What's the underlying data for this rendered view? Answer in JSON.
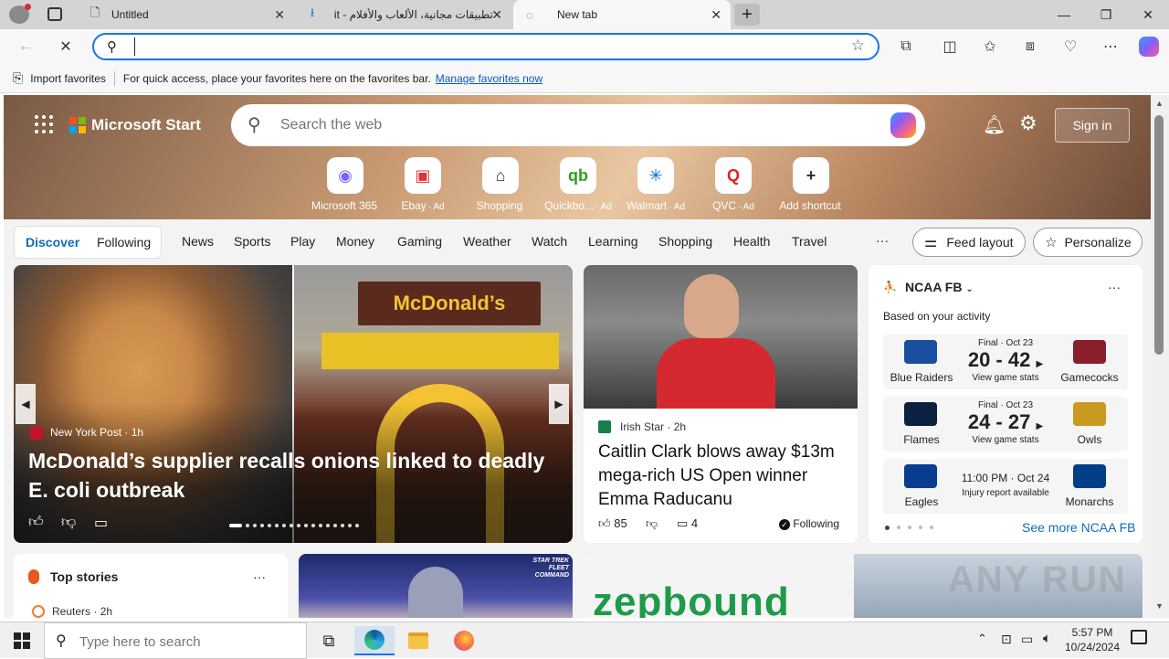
{
  "browser": {
    "tabs": [
      {
        "label": "Untitled",
        "close": "✕"
      },
      {
        "label": "تطبيقات مجانية، الألعاب والأفلام - it",
        "close": "✕"
      },
      {
        "label": "New tab",
        "close": "✕"
      }
    ],
    "new_tab_symbol": "+",
    "window_controls": {
      "minimize": "—",
      "maximize": "❐",
      "close": "✕"
    },
    "address": {
      "value": "",
      "placeholder": ""
    },
    "favorites_bar": {
      "import_label": "Import favorites",
      "message": "For quick access, place your favorites here on the favorites bar.",
      "manage_link": "Manage favorites now"
    }
  },
  "msn": {
    "brand": "Microsoft Start",
    "search_placeholder": "Search the web",
    "sign_in": "Sign in",
    "shortcuts": [
      {
        "label": "Microsoft 365",
        "ad": "",
        "icon": "microsoft-365-icon",
        "glyph": "◉",
        "color": "#7b61ff"
      },
      {
        "label": "Ebay",
        "ad": "· Ad",
        "icon": "ebay-icon",
        "glyph": "▣",
        "color": "#e53238"
      },
      {
        "label": "Shopping",
        "ad": "",
        "icon": "shopping-tag-icon",
        "glyph": "⌂",
        "color": "#333333"
      },
      {
        "label": "Quickbo...",
        "ad": "· Ad",
        "icon": "quickbooks-icon",
        "glyph": "qb",
        "color": "#2ca01c"
      },
      {
        "label": "Walmart",
        "ad": "· Ad",
        "icon": "walmart-icon",
        "glyph": "✳",
        "color": "#0071ce"
      },
      {
        "label": "QVC",
        "ad": "· Ad",
        "icon": "qvc-icon",
        "glyph": "Q",
        "color": "#e02020"
      },
      {
        "label": "Add shortcut",
        "ad": "",
        "icon": "add-shortcut-icon",
        "glyph": "+",
        "color": "#333333"
      }
    ],
    "tabs": {
      "discover": "Discover",
      "following": "Following"
    },
    "nav": [
      "News",
      "Sports",
      "Play",
      "Money",
      "Gaming",
      "Weather",
      "Watch",
      "Learning",
      "Shopping",
      "Health",
      "Travel"
    ],
    "more": "···",
    "feed_layout": "Feed layout",
    "personalize": "Personalize",
    "hero_story": {
      "source": "New York Post",
      "age": "1h",
      "headline": "McDonald’s supplier recalls onions linked to deadly E. coli outbreak"
    },
    "second_story": {
      "source": "Irish Star",
      "age": "2h",
      "headline": "Caitlin Clark blows away $13m mega-rich US Open winner Emma Raducanu",
      "likes": "85",
      "comments": "4",
      "following": "Following"
    },
    "ncaa": {
      "title": "NCAA FB",
      "subtitle": "Based on your activity",
      "more": "···",
      "games": [
        {
          "status": "Final · Oct 23",
          "score": "20 - 42",
          "link": "View game stats",
          "home": "Blue Raiders",
          "away": "Gamecocks",
          "home_color": "#1a4fa0",
          "away_color": "#8b1e2b"
        },
        {
          "status": "Final · Oct 23",
          "score": "24 - 27",
          "link": "View game stats",
          "home": "Flames",
          "away": "Owls",
          "home_color": "#0a2240",
          "away_color": "#c99a1f"
        },
        {
          "status": "11:00 PM · Oct 24",
          "score": "",
          "link": "Injury report available",
          "home": "Eagles",
          "away": "Monarchs",
          "home_color": "#0a3d91",
          "away_color": "#003f87"
        }
      ],
      "see_more": "See more NCAA FB"
    },
    "top_stories": {
      "title": "Top stories",
      "more": "···",
      "first_source": "Reuters",
      "first_age": "2h"
    },
    "lower_tiles": {
      "star_trek": "STAR TREK FLEET COMMAND",
      "zepbound": "zepbound"
    }
  },
  "taskbar": {
    "search_placeholder": "Type here to search",
    "time": "5:57 PM",
    "date": "10/24/2024"
  },
  "watermark": "ANY RUN"
}
